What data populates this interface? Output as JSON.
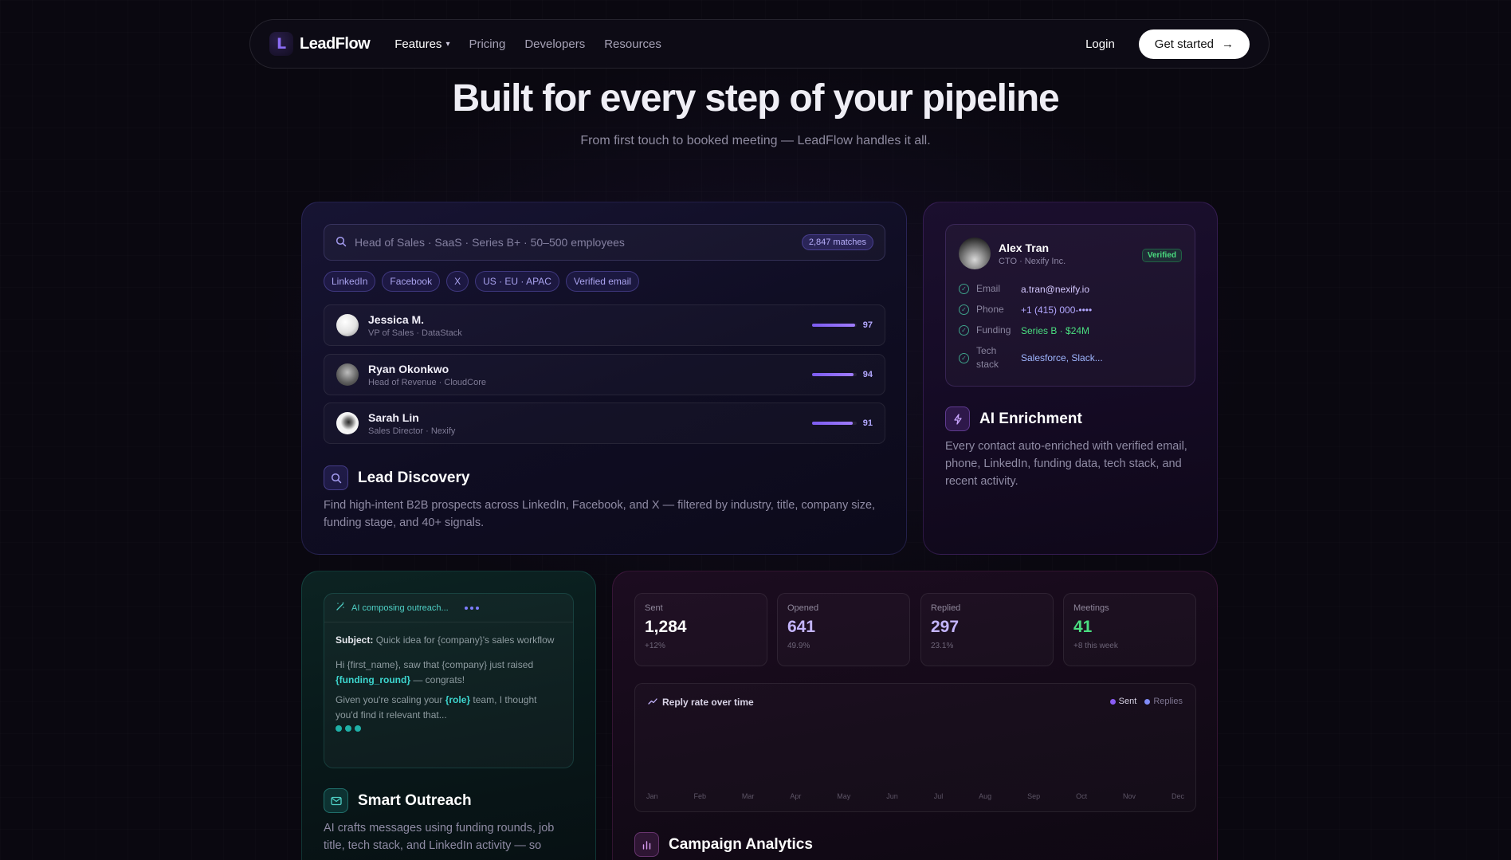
{
  "nav": {
    "logo_letter": "L",
    "brand": "LeadFlow",
    "links": [
      "Features",
      "Pricing",
      "Developers",
      "Resources"
    ],
    "login": "Login",
    "cta": "Get started",
    "cta_arrow": "→"
  },
  "hero": {
    "title": "Built for every step of your pipeline",
    "subtitle": "From first touch to booked meeting — LeadFlow handles it all."
  },
  "discovery": {
    "search_placeholder": "Head of Sales · SaaS · Series B+ · 50–500 employees",
    "matches": "2,847 matches",
    "filters": [
      "LinkedIn",
      "Facebook",
      "X",
      "US · EU · APAC",
      "Verified email"
    ],
    "leads": [
      {
        "name": "Jessica M.",
        "role": "VP of Sales · DataStack",
        "score": "97"
      },
      {
        "name": "Ryan Okonkwo",
        "role": "Head of Revenue · CloudCore",
        "score": "94"
      },
      {
        "name": "Sarah Lin",
        "role": "Sales Director · Nexify",
        "score": "91"
      }
    ],
    "title": "Lead Discovery",
    "description": "Find high-intent B2B prospects across LinkedIn, Facebook, and X — filtered by industry, title, company size, funding stage, and 40+ signals."
  },
  "enrichment": {
    "name": "Alex Tran",
    "role": "CTO · Nexify Inc.",
    "badge": "Verified",
    "fields": [
      {
        "label": "Email",
        "value": "a.tran@nexify.io"
      },
      {
        "label": "Phone",
        "value": "+1 (415) 000-••••"
      },
      {
        "label": "Funding",
        "value": "Series B · $24M"
      },
      {
        "label": "Tech stack",
        "value": "Salesforce, Slack..."
      }
    ],
    "title": "AI Enrichment",
    "description": "Every contact auto-enriched with verified email, phone, LinkedIn, funding data, tech stack, and recent activity."
  },
  "outreach": {
    "status": "AI composing outreach...",
    "subject_label": "Subject:",
    "subject": "Quick idea for {company}'s sales workflow",
    "line1a": "Hi {first_name}, saw that {company} just raised",
    "line1_hl": "{funding_round}",
    "line1b": "— congrats!",
    "line2a": "Given you're scaling your",
    "line2_hl": "{role}",
    "line2b": "team, I thought you'd find it relevant that...",
    "title": "Smart Outreach",
    "description": "AI crafts messages using funding rounds, job title, tech stack, and LinkedIn activity — so"
  },
  "analytics": {
    "stats": [
      {
        "label": "Sent",
        "value": "1,284",
        "delta": "+12%",
        "color": "#ffffff"
      },
      {
        "label": "Opened",
        "value": "641",
        "delta": "49.9%",
        "color": "#c4b5fd"
      },
      {
        "label": "Replied",
        "value": "297",
        "delta": "23.1%",
        "color": "#c4b5fd"
      },
      {
        "label": "Meetings",
        "value": "41",
        "delta": "+8 this week",
        "color": "#4ade80"
      }
    ],
    "chart_title": "Reply rate over time",
    "legend": [
      "Sent",
      "Replies"
    ],
    "months": [
      "Jan",
      "Feb",
      "Mar",
      "Apr",
      "May",
      "Jun",
      "Jul",
      "Aug",
      "Sep",
      "Oct",
      "Nov",
      "Dec"
    ],
    "title": "Campaign Analytics"
  },
  "colors": {
    "accent_purple": "#8b6cf5",
    "accent_teal": "#3dd6cf",
    "accent_green": "#4ade80"
  }
}
